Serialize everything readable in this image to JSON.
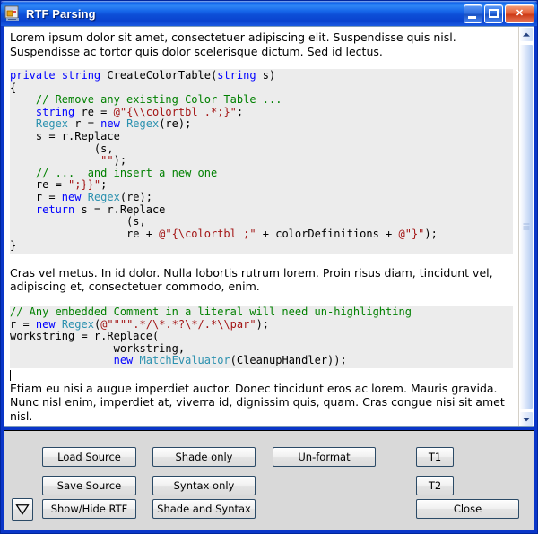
{
  "window": {
    "title": "RTF Parsing",
    "icon": "application-window-icon",
    "caption": {
      "minimize": "minimize-icon",
      "maximize": "maximize-icon",
      "close": "close-icon",
      "close_glyph": "✕"
    }
  },
  "document": {
    "paragraph_1": "Lorem ipsum dolor sit amet, consectetuer adipiscing elit. Suspendisse quis nisl. Suspendisse ac tortor quis dolor scelerisque dictum. Sed id lectus.",
    "code_block_1": [
      [
        {
          "t": "private",
          "c": "kw"
        },
        {
          "t": " ",
          "c": "pln"
        },
        {
          "t": "string",
          "c": "kw"
        },
        {
          "t": " CreateColorTable(",
          "c": "pln"
        },
        {
          "t": "string",
          "c": "kw"
        },
        {
          "t": " s)",
          "c": "pln"
        }
      ],
      [
        {
          "t": "{",
          "c": "pln"
        }
      ],
      [
        {
          "t": "    ",
          "c": "pln"
        },
        {
          "t": "// Remove any existing Color Table ...",
          "c": "cmt"
        }
      ],
      [
        {
          "t": "    ",
          "c": "pln"
        },
        {
          "t": "string",
          "c": "kw"
        },
        {
          "t": " re = ",
          "c": "pln"
        },
        {
          "t": "@\"{\\\\colortbl .*;}\"",
          "c": "str"
        },
        {
          "t": ";",
          "c": "pln"
        }
      ],
      [
        {
          "t": "    ",
          "c": "pln"
        },
        {
          "t": "Regex",
          "c": "typ"
        },
        {
          "t": " r = ",
          "c": "pln"
        },
        {
          "t": "new",
          "c": "kw"
        },
        {
          "t": " ",
          "c": "pln"
        },
        {
          "t": "Regex",
          "c": "typ"
        },
        {
          "t": "(re);",
          "c": "pln"
        }
      ],
      [
        {
          "t": "    s = r.Replace",
          "c": "pln"
        }
      ],
      [
        {
          "t": "             (s,",
          "c": "pln"
        }
      ],
      [
        {
          "t": "              ",
          "c": "pln"
        },
        {
          "t": "\"\"",
          "c": "str"
        },
        {
          "t": ");",
          "c": "pln"
        }
      ],
      [
        {
          "t": "",
          "c": "pln"
        }
      ],
      [
        {
          "t": "    ",
          "c": "pln"
        },
        {
          "t": "// ...  and insert a new one",
          "c": "cmt"
        }
      ],
      [
        {
          "t": "    re = ",
          "c": "pln"
        },
        {
          "t": "\";}}\"",
          "c": "str"
        },
        {
          "t": ";",
          "c": "pln"
        }
      ],
      [
        {
          "t": "    r = ",
          "c": "pln"
        },
        {
          "t": "new",
          "c": "kw"
        },
        {
          "t": " ",
          "c": "pln"
        },
        {
          "t": "Regex",
          "c": "typ"
        },
        {
          "t": "(re);",
          "c": "pln"
        }
      ],
      [
        {
          "t": "    ",
          "c": "pln"
        },
        {
          "t": "return",
          "c": "kw"
        },
        {
          "t": " s = r.Replace",
          "c": "pln"
        }
      ],
      [
        {
          "t": "                  (s,",
          "c": "pln"
        }
      ],
      [
        {
          "t": "                  re + ",
          "c": "pln"
        },
        {
          "t": "@\"{\\colortbl ;\"",
          "c": "str"
        },
        {
          "t": " + colorDefinitions + ",
          "c": "pln"
        },
        {
          "t": "@\"}\"",
          "c": "str"
        },
        {
          "t": ");",
          "c": "pln"
        }
      ],
      [
        {
          "t": "}",
          "c": "pln"
        }
      ]
    ],
    "paragraph_2": "Cras vel metus. In id dolor. Nulla lobortis rutrum lorem. Proin risus diam, tincidunt vel, adipiscing et, consectetuer commodo, enim.",
    "code_block_2": [
      [
        {
          "t": "// Any embedded Comment in a literal will need un-highlighting",
          "c": "cmt"
        }
      ],
      [
        {
          "t": "r = ",
          "c": "pln"
        },
        {
          "t": "new",
          "c": "kw"
        },
        {
          "t": " ",
          "c": "pln"
        },
        {
          "t": "Regex",
          "c": "typ"
        },
        {
          "t": "(",
          "c": "pln"
        },
        {
          "t": "@\"\"\"\".*/\\*.*?\\*/.*\\\\par\"",
          "c": "str"
        },
        {
          "t": ");",
          "c": "pln"
        }
      ],
      [
        {
          "t": "workstring = r.Replace(",
          "c": "pln"
        }
      ],
      [
        {
          "t": "                workstring,",
          "c": "pln"
        }
      ],
      [
        {
          "t": "                ",
          "c": "pln"
        },
        {
          "t": "new",
          "c": "kw"
        },
        {
          "t": " ",
          "c": "pln"
        },
        {
          "t": "MatchEvaluator",
          "c": "typ"
        },
        {
          "t": "(CleanupHandler));",
          "c": "pln"
        }
      ]
    ],
    "paragraph_3": "Etiam eu nisi a augue imperdiet auctor. Donec tincidunt eros ac lorem. Mauris gravida. Nunc nisl enim, imperdiet at, viverra id, dignissim quis, quam. Cras congue nisi sit amet nisl."
  },
  "scrollbar": {
    "up_arrow": "scroll-up-icon",
    "down_arrow": "scroll-down-icon",
    "thumb": "scroll-thumb"
  },
  "buttons": {
    "load_source": "Load Source",
    "save_source": "Save Source",
    "show_hide_rtf": "Show/Hide RTF",
    "shade_only": "Shade only",
    "syntax_only": "Syntax only",
    "shade_and_syntax": "Shade and Syntax",
    "un_format": "Un-format",
    "t1": "T1",
    "t2": "T2",
    "close": "Close",
    "expand_arrow": "down-triangle-icon"
  },
  "colors": {
    "titlebar_blue": "#0a4fd8",
    "frame_blue": "#0a36c8",
    "panel_gray": "#d9d9d9",
    "code_bg": "#ececec",
    "keyword": "#0000ff",
    "type": "#2b91af",
    "string": "#a31515",
    "comment": "#008000"
  }
}
